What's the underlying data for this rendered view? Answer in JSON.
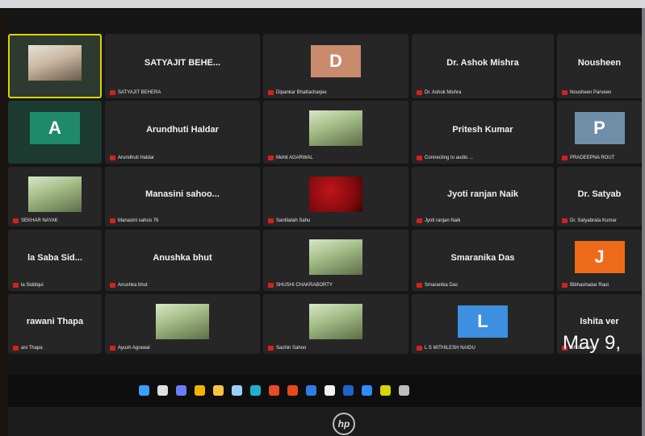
{
  "participants": [
    {
      "name": "",
      "tag": "",
      "avatar_letter": "",
      "tile_color": "#2e3a30",
      "photo": "person-portrait"
    },
    {
      "name": "SATYAJIT BEHE...",
      "tag": "SATYAJIT BEHERA",
      "avatar_letter": "",
      "tile_color": "#262626"
    },
    {
      "name": "",
      "tag": "Dipankar Bhattacharjee",
      "avatar_letter": "D",
      "tile_color": "#262626",
      "avatar_color": "#c98a6e"
    },
    {
      "name": "Dr. Ashok Mishra",
      "tag": "Dr. Ashok Mishra",
      "avatar_letter": "",
      "tile_color": "#262626"
    },
    {
      "name": "Nousheen",
      "tag": "Nousheen Parveen",
      "avatar_letter": "",
      "tile_color": "#262626"
    },
    {
      "name": "",
      "tag": "",
      "avatar_letter": "A",
      "tile_color": "#1d3a30",
      "avatar_color": "#1f8a6a"
    },
    {
      "name": "Arundhuti Haldar",
      "tag": "Arundhuti Haldar",
      "avatar_letter": "",
      "tile_color": "#262626"
    },
    {
      "name": "",
      "tag": "Mohit AGARWAL",
      "avatar_letter": "",
      "tile_color": "#262626",
      "photo": "person-photo"
    },
    {
      "name": "Pritesh Kumar",
      "tag": "Connecting to audio ...",
      "avatar_letter": "",
      "tile_color": "#262626"
    },
    {
      "name": "",
      "tag": "PRADEEPNA ROUT",
      "avatar_letter": "P",
      "tile_color": "#262626",
      "avatar_color": "#6f8fa8"
    },
    {
      "name": "",
      "tag": "SEKHAR NAYAK",
      "avatar_letter": "",
      "tile_color": "#262626",
      "photo": "person-photo"
    },
    {
      "name": "Manasini sahoo...",
      "tag": "Manasini sahoo 76",
      "avatar_letter": "",
      "tile_color": "#262626"
    },
    {
      "name": "",
      "tag": "Santilatah Sahu",
      "avatar_letter": "",
      "tile_color": "#262626",
      "photo": "red-image"
    },
    {
      "name": "Jyoti ranjan Naik",
      "tag": "Jyoti ranjan Naik",
      "avatar_letter": "",
      "tile_color": "#262626"
    },
    {
      "name": "Dr. Satyab",
      "tag": "Dr. Satyabrata Kumar",
      "avatar_letter": "",
      "tile_color": "#262626"
    },
    {
      "name": "la Saba Sid...",
      "tag": "la Siddiqui",
      "avatar_letter": "",
      "tile_color": "#262626"
    },
    {
      "name": "Anushka bhut",
      "tag": "Anushka bhut",
      "avatar_letter": "",
      "tile_color": "#262626"
    },
    {
      "name": "",
      "tag": "SHUSHI CHAKRABORTY",
      "avatar_letter": "",
      "tile_color": "#262626",
      "photo": "person-photo"
    },
    {
      "name": "Smaranika Das",
      "tag": "Smaranika Das",
      "avatar_letter": "",
      "tile_color": "#262626"
    },
    {
      "name": "",
      "tag": "Bibhashadar Raut",
      "avatar_letter": "J",
      "tile_color": "#262626",
      "avatar_color": "#ee6a1a"
    },
    {
      "name": "rawani Thapa",
      "tag": "ani Thapa",
      "avatar_letter": "",
      "tile_color": "#262626"
    },
    {
      "name": "",
      "tag": "Ayush Agrawal",
      "avatar_letter": "",
      "tile_color": "#262626",
      "photo": "person-photo"
    },
    {
      "name": "",
      "tag": "Sachin Sahoo",
      "avatar_letter": "",
      "tile_color": "#262626",
      "photo": "person-photo"
    },
    {
      "name": "",
      "tag": "L S MITHILESH NAIDU",
      "avatar_letter": "L",
      "tile_color": "#262626",
      "avatar_color": "#3d8fe0"
    },
    {
      "name": "Ishita ver",
      "tag": "Ishita verma",
      "avatar_letter": "",
      "tile_color": "#262626"
    }
  ],
  "date_overlay": "May 9,",
  "brand_logo": "hp",
  "taskbar_icons": [
    "windows-start-icon",
    "search-icon",
    "chat-icon",
    "chrome-icon",
    "file-explorer-icon",
    "mail-icon",
    "edge-icon",
    "app-icon",
    "office-icon",
    "store-icon",
    "camera-icon",
    "outlook-icon",
    "zoom-icon",
    "app-icon-2",
    "app-icon-3"
  ]
}
